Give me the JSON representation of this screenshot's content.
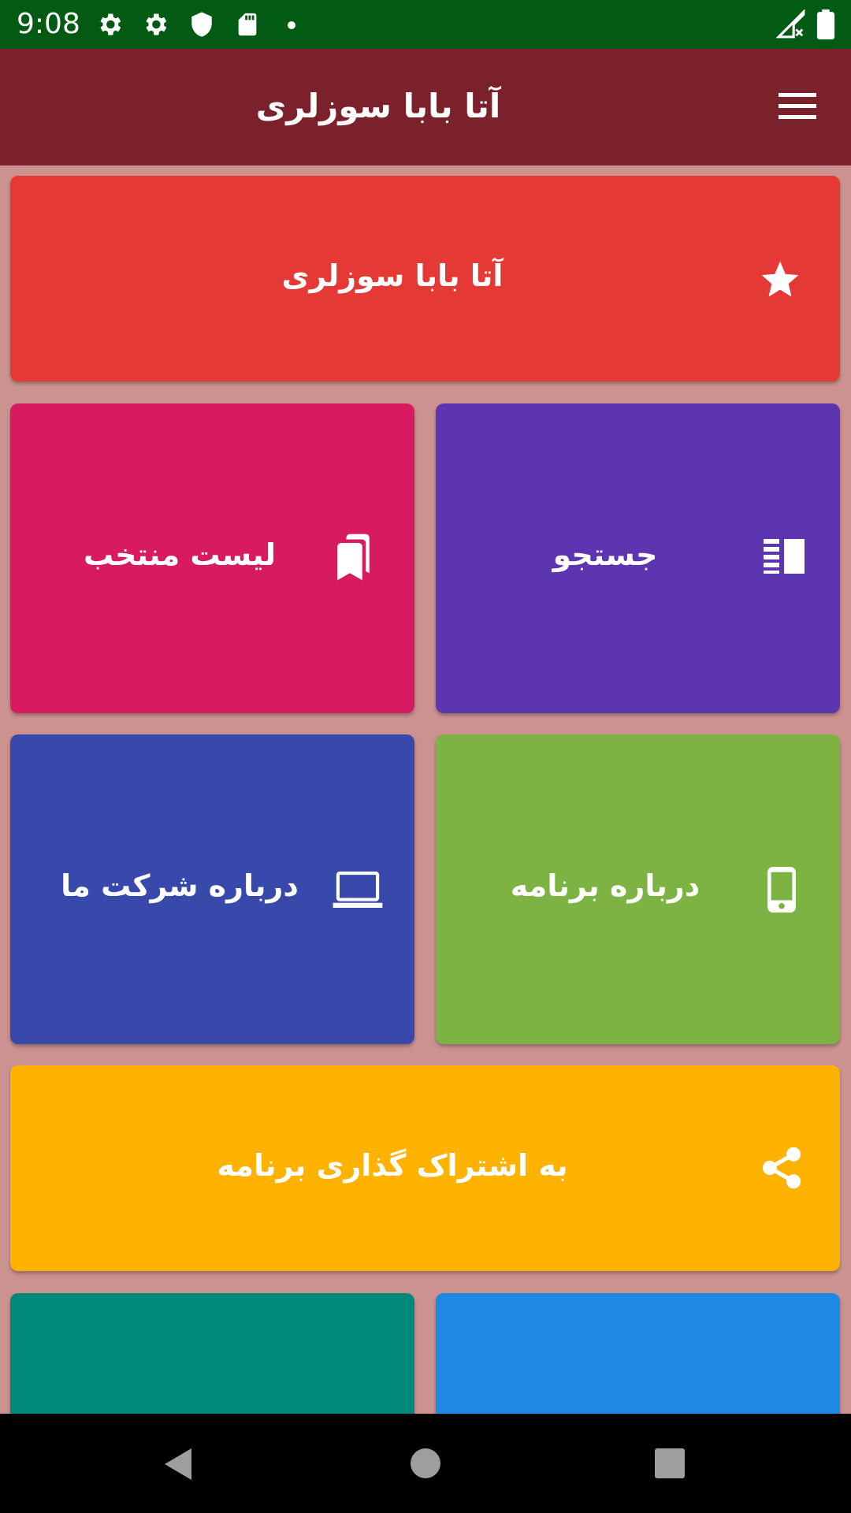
{
  "status_bar": {
    "time": "9:08",
    "background": "#035a12",
    "icons": [
      "gear-icon",
      "gear-icon",
      "shield-icon",
      "sd-card-icon",
      "dot-icon",
      "no-signal-icon",
      "battery-icon"
    ]
  },
  "app_bar": {
    "title": "آتا بابا سوزلری",
    "background": "#7b212c",
    "menu_icon": "hamburger-menu-icon"
  },
  "page_background": "#cb9290",
  "tiles": {
    "featured": {
      "label": "آتا بابا سوزلری",
      "icon": "star-icon",
      "color": "#e53935"
    },
    "search": {
      "label": "جستجو",
      "icon": "view-list-icon",
      "color": "#5e35b1"
    },
    "favorites": {
      "label": "لیست منتخب",
      "icon": "bookmarks-icon",
      "color": "#d81b60"
    },
    "about_app": {
      "label": "درباره برنامه",
      "icon": "smartphone-icon",
      "color": "#7cb342"
    },
    "about_company": {
      "label": "درباره شرکت ما",
      "icon": "laptop-icon",
      "color": "#3949ab"
    },
    "share": {
      "label": "به اشتراک گذاری برنامه",
      "icon": "share-icon",
      "color": "#ffb300"
    },
    "partial_left": {
      "color": "#00897b"
    },
    "partial_right": {
      "color": "#1e88e5"
    }
  },
  "nav_bar": {
    "buttons": [
      "back-icon",
      "home-icon",
      "recents-icon"
    ]
  }
}
